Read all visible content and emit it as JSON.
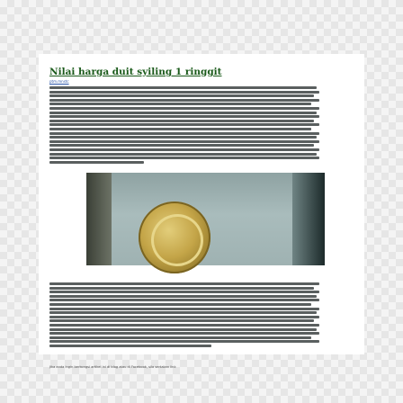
{
  "article": {
    "title": "Nilai harga duit syiling 1 ringgit",
    "subtitle": "ptm.mnstc",
    "caption": "Jika anda ingin berkongsi artikel ini di blog atau di Facebook, sila sertakan link"
  }
}
